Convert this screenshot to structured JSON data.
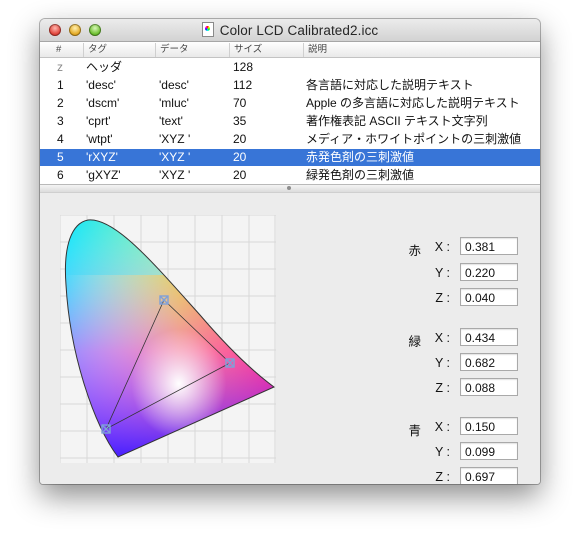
{
  "window": {
    "title": "Color LCD Calibrated2.icc"
  },
  "table": {
    "columns": [
      "#",
      "タグ",
      "データ",
      "サイズ",
      "説明"
    ],
    "rows": [
      {
        "num": "z",
        "tag": "ヘッダ",
        "data": "",
        "size": "128",
        "desc": ""
      },
      {
        "num": "1",
        "tag": "'desc'",
        "data": "'desc'",
        "size": "112",
        "desc": "各言語に対応した説明テキスト"
      },
      {
        "num": "2",
        "tag": "'dscm'",
        "data": "'mluc'",
        "size": "70",
        "desc": "Apple の多言語に対応した説明テキスト"
      },
      {
        "num": "3",
        "tag": "'cprt'",
        "data": "'text'",
        "size": "35",
        "desc": "著作権表記 ASCII テキスト文字列"
      },
      {
        "num": "4",
        "tag": "'wtpt'",
        "data": "'XYZ '",
        "size": "20",
        "desc": "メディア・ホワイトポイントの三刺激値"
      },
      {
        "num": "5",
        "tag": "'rXYZ'",
        "data": "'XYZ '",
        "size": "20",
        "desc": "赤発色剤の三刺激値"
      },
      {
        "num": "6",
        "tag": "'gXYZ'",
        "data": "'XYZ '",
        "size": "20",
        "desc": "緑発色剤の三刺激値"
      }
    ],
    "selected_row": 5
  },
  "colorants": {
    "red": {
      "label": "赤",
      "X": "0.381",
      "Y": "0.220",
      "Z": "0.040"
    },
    "green": {
      "label": "緑",
      "X": "0.434",
      "Y": "0.682",
      "Z": "0.088"
    },
    "blue": {
      "label": "青",
      "X": "0.150",
      "Y": "0.099",
      "Z": "0.697"
    }
  },
  "axis_labels": {
    "X": "X :",
    "Y": "Y :",
    "Z": "Z :"
  }
}
